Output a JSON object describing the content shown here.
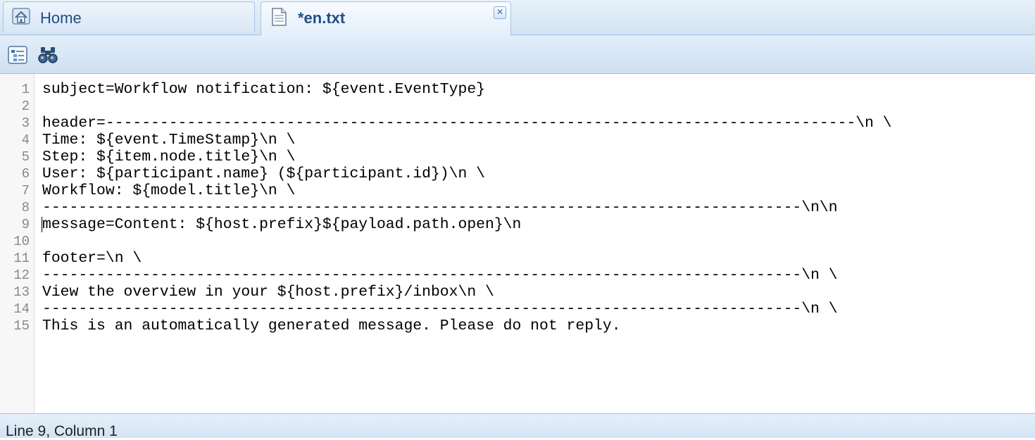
{
  "tabs": [
    {
      "label": "Home",
      "icon": "home-icon",
      "active": false
    },
    {
      "label": "*en.txt",
      "icon": "document-icon",
      "active": true,
      "close_glyph": "✕"
    }
  ],
  "toolbar": {
    "buttons": [
      {
        "icon": "outline-icon"
      },
      {
        "icon": "find-binoculars-icon"
      }
    ]
  },
  "editor": {
    "lines": [
      {
        "num": "1",
        "text": "subject=Workflow notification: ${event.EventType}"
      },
      {
        "num": "2",
        "text": ""
      },
      {
        "num": "3",
        "text": "header=-----------------------------------------------------------------------------------\\n \\"
      },
      {
        "num": "4",
        "text": "Time: ${event.TimeStamp}\\n \\"
      },
      {
        "num": "5",
        "text": "Step: ${item.node.title}\\n \\"
      },
      {
        "num": "6",
        "text": "User: ${participant.name} (${participant.id})\\n \\"
      },
      {
        "num": "7",
        "text": "Workflow: ${model.title}\\n \\"
      },
      {
        "num": "8",
        "text": "------------------------------------------------------------------------------------\\n\\n"
      },
      {
        "num": "9",
        "text": "message=Content: ${host.prefix}${payload.path.open}\\n"
      },
      {
        "num": "10",
        "text": ""
      },
      {
        "num": "11",
        "text": "footer=\\n \\"
      },
      {
        "num": "12",
        "text": "------------------------------------------------------------------------------------\\n \\"
      },
      {
        "num": "13",
        "text": "View the overview in your ${host.prefix}/inbox\\n \\"
      },
      {
        "num": "14",
        "text": "------------------------------------------------------------------------------------\\n \\"
      },
      {
        "num": "15",
        "text": "This is an automatically generated message. Please do not reply."
      }
    ]
  },
  "status": {
    "text": "Line 9, Column 1"
  },
  "colors": {
    "accent": "#1f4e86",
    "chrome": "#d3e3f3",
    "border": "#9fbfe0"
  }
}
